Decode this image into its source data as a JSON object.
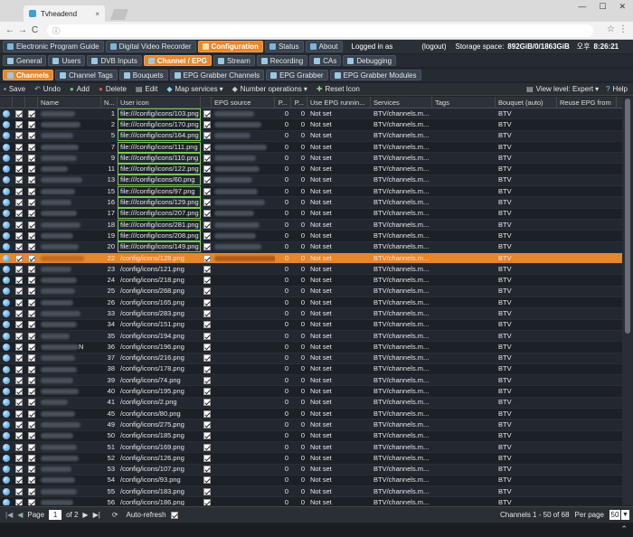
{
  "browser": {
    "tab_title": "Tvheadend",
    "tab_close": "×",
    "nav_back": "←",
    "nav_forward": "→",
    "nav_reload": "C",
    "info": "ⓘ",
    "star": "☆",
    "menu": "⋮",
    "win_min": "—",
    "win_max": "☐",
    "win_close": "✕"
  },
  "mainnav": {
    "tabs": [
      {
        "label": "Electronic Program Guide",
        "active": false
      },
      {
        "label": "Digital Video Recorder",
        "active": false
      },
      {
        "label": "Configuration",
        "active": true
      },
      {
        "label": "Status",
        "active": false
      },
      {
        "label": "About",
        "active": false
      }
    ],
    "logged_in": "Logged in as",
    "logout": "(logout)",
    "storage_label": "Storage space:",
    "storage_value": "892GiB/0/1863GiB",
    "time_prefix": "오후",
    "time_value": "8:26:21"
  },
  "subnav": {
    "tabs": [
      {
        "label": "General",
        "active": false
      },
      {
        "label": "Users",
        "active": false
      },
      {
        "label": "DVB Inputs",
        "active": false
      },
      {
        "label": "Channel / EPG",
        "active": true
      },
      {
        "label": "Stream",
        "active": false
      },
      {
        "label": "Recording",
        "active": false
      },
      {
        "label": "CAs",
        "active": false
      },
      {
        "label": "Debugging",
        "active": false
      }
    ]
  },
  "subnav2": {
    "tabs": [
      {
        "label": "Channels",
        "active": true
      },
      {
        "label": "Channel Tags",
        "active": false
      },
      {
        "label": "Bouquets",
        "active": false
      },
      {
        "label": "EPG Grabber Channels",
        "active": false
      },
      {
        "label": "EPG Grabber",
        "active": false
      },
      {
        "label": "EPG Grabber Modules",
        "active": false
      }
    ]
  },
  "toolbar": {
    "save": "Save",
    "undo": "Undo",
    "add": "Add",
    "delete": "Delete",
    "edit": "Edit",
    "map_services": "Map services",
    "number_operations": "Number operations",
    "reset_icon": "Reset Icon",
    "view_level": "View level: Expert",
    "help": "Help"
  },
  "grid": {
    "headers": [
      "",
      "",
      "",
      "Name",
      "N...",
      "User icon",
      "",
      "EPG source",
      "P...",
      "P...",
      "Use EPG runnin...",
      "Services",
      "Tags",
      "Bouquet (auto)",
      "Reuse EPG from"
    ],
    "rows": [
      {
        "num": "1",
        "icon": "file:///config/icons/103.png",
        "p1": "0",
        "p2": "0",
        "running": "Not set",
        "services": "BTV/channels.m...",
        "bouquet": "BTV",
        "edit": true
      },
      {
        "num": "2",
        "icon": "file:///config/icons/170.png",
        "p1": "0",
        "p2": "0",
        "running": "Not set",
        "services": "BTV/channels.m...",
        "bouquet": "BTV",
        "edit": true
      },
      {
        "num": "5",
        "icon": "file:///config/icons/164.png",
        "p1": "0",
        "p2": "0",
        "running": "Not set",
        "services": "BTV/channels.m...",
        "bouquet": "BTV",
        "edit": true
      },
      {
        "num": "7",
        "icon": "file:///config/icons/111.png",
        "p1": "0",
        "p2": "0",
        "running": "Not set",
        "services": "BTV/channels.m...",
        "bouquet": "BTV",
        "edit": true
      },
      {
        "num": "9",
        "icon": "file:///config/icons/110.png",
        "p1": "0",
        "p2": "0",
        "running": "Not set",
        "services": "BTV/channels.m...",
        "bouquet": "BTV",
        "edit": true
      },
      {
        "num": "11",
        "icon": "file:///config/icons/122.png",
        "p1": "0",
        "p2": "0",
        "running": "Not set",
        "services": "BTV/channels.m...",
        "bouquet": "BTV",
        "edit": true
      },
      {
        "num": "13",
        "icon": "file:///config/icons/60.png",
        "p1": "0",
        "p2": "0",
        "running": "Not set",
        "services": "BTV/channels.m...",
        "bouquet": "BTV",
        "edit": true
      },
      {
        "num": "15",
        "icon": "file:///config/icons/97.png",
        "p1": "0",
        "p2": "0",
        "running": "Not set",
        "services": "BTV/channels.m...",
        "bouquet": "BTV",
        "edit": true
      },
      {
        "num": "16",
        "icon": "file:///config/icons/129.png",
        "p1": "0",
        "p2": "0",
        "running": "Not set",
        "services": "BTV/channels.m...",
        "bouquet": "BTV",
        "edit": true
      },
      {
        "num": "17",
        "icon": "file:///config/icons/207.png",
        "p1": "0",
        "p2": "0",
        "running": "Not set",
        "services": "BTV/channels.m...",
        "bouquet": "BTV",
        "edit": true
      },
      {
        "num": "18",
        "icon": "file:///config/icons/281.png",
        "p1": "0",
        "p2": "0",
        "running": "Not set",
        "services": "BTV/channels.m...",
        "bouquet": "BTV",
        "edit": true
      },
      {
        "num": "19",
        "icon": "file:///config/icons/208.png",
        "p1": "0",
        "p2": "0",
        "running": "Not set",
        "services": "BTV/channels.m...",
        "bouquet": "BTV",
        "edit": true
      },
      {
        "num": "20",
        "icon": "file:///config/icons/149.png",
        "p1": "0",
        "p2": "0",
        "running": "Not set",
        "services": "BTV/channels.m...",
        "bouquet": "BTV",
        "edit": true
      },
      {
        "num": "22",
        "icon": "/config/icons/128.png",
        "p1": "0",
        "p2": "0",
        "running": "Not set",
        "services": "BTV/channels.m...",
        "bouquet": "BTV",
        "selected": true
      },
      {
        "num": "23",
        "icon": "/config/icons/121.png",
        "p1": "0",
        "p2": "0",
        "running": "Not set",
        "services": "BTV/channels.m...",
        "bouquet": "BTV"
      },
      {
        "num": "24",
        "icon": "/config/icons/218.png",
        "p1": "0",
        "p2": "0",
        "running": "Not set",
        "services": "BTV/channels.m...",
        "bouquet": "BTV"
      },
      {
        "num": "25",
        "icon": "/config/icons/268.png",
        "p1": "0",
        "p2": "0",
        "running": "Not set",
        "services": "BTV/channels.m...",
        "bouquet": "BTV"
      },
      {
        "num": "26",
        "icon": "/config/icons/165.png",
        "p1": "0",
        "p2": "0",
        "running": "Not set",
        "services": "BTV/channels.m...",
        "bouquet": "BTV"
      },
      {
        "num": "33",
        "icon": "/config/icons/283.png",
        "p1": "0",
        "p2": "0",
        "running": "Not set",
        "services": "BTV/channels.m...",
        "bouquet": "BTV"
      },
      {
        "num": "34",
        "icon": "/config/icons/151.png",
        "p1": "0",
        "p2": "0",
        "running": "Not set",
        "services": "BTV/channels.m...",
        "bouquet": "BTV"
      },
      {
        "num": "35",
        "icon": "/config/icons/194.png",
        "p1": "0",
        "p2": "0",
        "running": "Not set",
        "services": "BTV/channels.m...",
        "bouquet": "BTV"
      },
      {
        "num": "36",
        "icon": "/config/icons/196.png",
        "p1": "0",
        "p2": "0",
        "running": "Not set",
        "services": "BTV/channels.m...",
        "bouquet": "BTV",
        "name_suffix": "N"
      },
      {
        "num": "37",
        "icon": "/config/icons/216.png",
        "p1": "0",
        "p2": "0",
        "running": "Not set",
        "services": "BTV/channels.m...",
        "bouquet": "BTV"
      },
      {
        "num": "38",
        "icon": "/config/icons/178.png",
        "p1": "0",
        "p2": "0",
        "running": "Not set",
        "services": "BTV/channels.m...",
        "bouquet": "BTV"
      },
      {
        "num": "39",
        "icon": "/config/icons/74.png",
        "p1": "0",
        "p2": "0",
        "running": "Not set",
        "services": "BTV/channels.m...",
        "bouquet": "BTV"
      },
      {
        "num": "40",
        "icon": "/config/icons/195.png",
        "p1": "0",
        "p2": "0",
        "running": "Not set",
        "services": "BTV/channels.m...",
        "bouquet": "BTV"
      },
      {
        "num": "41",
        "icon": "/config/icons/2.png",
        "p1": "0",
        "p2": "0",
        "running": "Not set",
        "services": "BTV/channels.m...",
        "bouquet": "BTV"
      },
      {
        "num": "45",
        "icon": "/config/icons/80.png",
        "p1": "0",
        "p2": "0",
        "running": "Not set",
        "services": "BTV/channels.m...",
        "bouquet": "BTV"
      },
      {
        "num": "49",
        "icon": "/config/icons/275.png",
        "p1": "0",
        "p2": "0",
        "running": "Not set",
        "services": "BTV/channels.m...",
        "bouquet": "BTV"
      },
      {
        "num": "50",
        "icon": "/config/icons/185.png",
        "p1": "0",
        "p2": "0",
        "running": "Not set",
        "services": "BTV/channels.m...",
        "bouquet": "BTV"
      },
      {
        "num": "51",
        "icon": "/config/icons/169.png",
        "p1": "0",
        "p2": "0",
        "running": "Not set",
        "services": "BTV/channels.m...",
        "bouquet": "BTV"
      },
      {
        "num": "52",
        "icon": "/config/icons/126.png",
        "p1": "0",
        "p2": "0",
        "running": "Not set",
        "services": "BTV/channels.m...",
        "bouquet": "BTV"
      },
      {
        "num": "53",
        "icon": "/config/icons/107.png",
        "p1": "0",
        "p2": "0",
        "running": "Not set",
        "services": "BTV/channels.m...",
        "bouquet": "BTV"
      },
      {
        "num": "54",
        "icon": "/config/icons/93.png",
        "p1": "0",
        "p2": "0",
        "running": "Not set",
        "services": "BTV/channels.m...",
        "bouquet": "BTV"
      },
      {
        "num": "55",
        "icon": "/config/icons/183.png",
        "p1": "0",
        "p2": "0",
        "running": "Not set",
        "services": "BTV/channels.m...",
        "bouquet": "BTV"
      },
      {
        "num": "56",
        "icon": "/config/icons/186.png",
        "p1": "0",
        "p2": "0",
        "running": "Not set",
        "services": "BTV/channels.m...",
        "bouquet": "BTV"
      }
    ]
  },
  "pager": {
    "page_label": "Page",
    "page_value": "1",
    "of_label": "of 2",
    "auto_refresh": "Auto-refresh",
    "summary": "Channels 1 - 50 of 68",
    "per_page_label": "Per page",
    "per_page_value": "50",
    "first": "|◀",
    "prev": "◀",
    "next": "▶",
    "last": "▶|",
    "refresh": "⟳",
    "per_page_arrow": "▼",
    "scroll_top": "⌃"
  },
  "colors": {
    "accent": "#e8862a",
    "background": "#1f232a",
    "edit_outline": "#7bc95a"
  }
}
